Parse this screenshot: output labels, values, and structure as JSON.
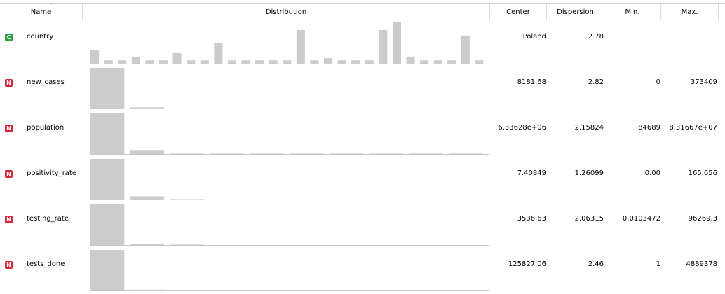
{
  "columns": {
    "name": "Name",
    "distribution": "Distribution",
    "center": "Center",
    "dispersion": "Dispersion",
    "min": "Min.",
    "max": "Max."
  },
  "colors": {
    "categorical": "#2ea043",
    "numeric": "#d6243b",
    "bar": "#cccccc"
  },
  "rows": [
    {
      "type": "C",
      "name": "country",
      "center": "Poland",
      "dispersion": "2.78",
      "min": "",
      "max": "",
      "histogram": [
        0.33,
        0.08,
        0.08,
        0.17,
        0.08,
        0.08,
        0.25,
        0.08,
        0.08,
        0.5,
        0.08,
        0.08,
        0.08,
        0.08,
        0.08,
        0.8,
        0.08,
        0.13,
        0.08,
        0.08,
        0.08,
        0.8,
        1.0,
        0.17,
        0.08,
        0.08,
        0.08,
        0.67,
        0.08
      ]
    },
    {
      "type": "N",
      "name": "new_cases",
      "center": "8181.68",
      "dispersion": "2.82",
      "min": "0",
      "max": "373409",
      "histogram": [
        1.0,
        0.03,
        0,
        0,
        0,
        0,
        0,
        0,
        0,
        0
      ]
    },
    {
      "type": "N",
      "name": "population",
      "center": "6.33628e+06",
      "dispersion": "2.15824",
      "min": "84689",
      "max": "8.31667e+07",
      "histogram": [
        1.0,
        0.1,
        0.01,
        0.01,
        0.01,
        0.01,
        0.01,
        0.01,
        0.01,
        0.01
      ]
    },
    {
      "type": "N",
      "name": "positivity_rate",
      "center": "7.40849",
      "dispersion": "1.26099",
      "min": "0.00",
      "max": "165.656",
      "histogram": [
        1.0,
        0.08,
        0.01,
        0,
        0,
        0,
        0,
        0,
        0,
        0
      ]
    },
    {
      "type": "N",
      "name": "testing_rate",
      "center": "3536.63",
      "dispersion": "2.06315",
      "min": "0.0103472",
      "max": "96269.3",
      "histogram": [
        1.0,
        0.03,
        0.01,
        0,
        0,
        0,
        0,
        0,
        0,
        0
      ]
    },
    {
      "type": "N",
      "name": "tests_done",
      "center": "125827.06",
      "dispersion": "2.46",
      "min": "1",
      "max": "4889378",
      "histogram": [
        1.0,
        0.02,
        0.01,
        0,
        0,
        0,
        0,
        0,
        0,
        0
      ]
    }
  ]
}
